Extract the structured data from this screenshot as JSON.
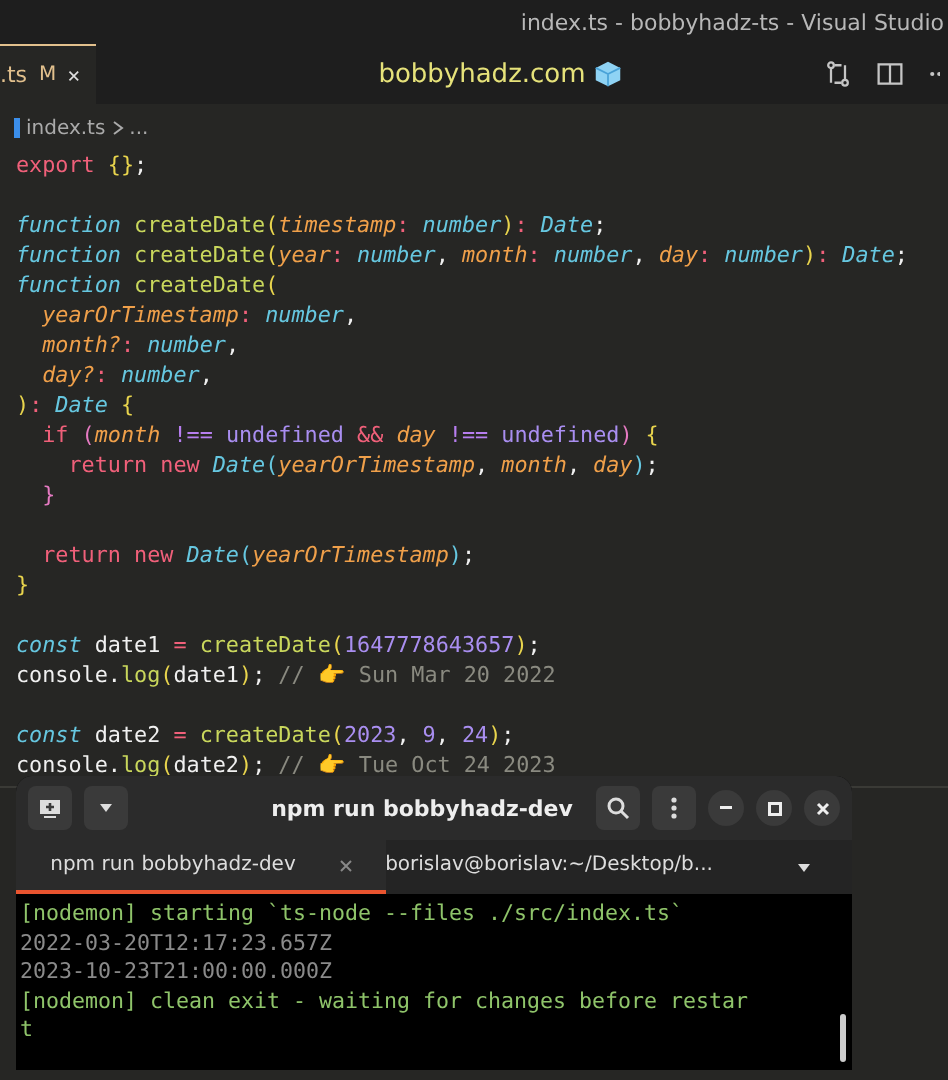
{
  "window": {
    "title": "index.ts - bobbyhadz-ts - Visual Studio"
  },
  "tabs": [
    {
      "label": ".ts",
      "status": "M",
      "selected": true
    }
  ],
  "banner": {
    "text": "bobbyhadz.com"
  },
  "breadcrumb": {
    "file": "index.ts",
    "rest": "..."
  },
  "code_blocks": [
    {
      "lines": [
        {
          "tokens": [
            {
              "kind": "kw",
              "text": "export"
            },
            {
              "kind": "brace",
              "text": " {}"
            },
            {
              "kind": "plain",
              "text": ";"
            }
          ]
        }
      ]
    },
    {
      "lines": [
        {
          "tokens": [
            {
              "kind": "storage",
              "text": "function"
            },
            {
              "kind": "fn",
              "text": " createDate"
            },
            {
              "kind": "brace",
              "text": "("
            },
            {
              "kind": "param",
              "text": "timestamp"
            },
            {
              "kind": "op",
              "text": ":"
            },
            {
              "kind": "type",
              "text": " number"
            },
            {
              "kind": "brace",
              "text": ")"
            },
            {
              "kind": "op",
              "text": ":"
            },
            {
              "kind": "type",
              "text": " Date"
            },
            {
              "kind": "plain",
              "text": ";"
            }
          ]
        },
        {
          "tokens": [
            {
              "kind": "storage",
              "text": "function"
            },
            {
              "kind": "fn",
              "text": " createDate"
            },
            {
              "kind": "brace",
              "text": "("
            },
            {
              "kind": "param",
              "text": "year"
            },
            {
              "kind": "op",
              "text": ":"
            },
            {
              "kind": "type",
              "text": " number"
            },
            {
              "kind": "plain",
              "text": ","
            },
            {
              "kind": "param",
              "text": " month"
            },
            {
              "kind": "op",
              "text": ":"
            },
            {
              "kind": "type",
              "text": " number"
            },
            {
              "kind": "plain",
              "text": ","
            },
            {
              "kind": "param",
              "text": " day"
            },
            {
              "kind": "op",
              "text": ":"
            },
            {
              "kind": "type",
              "text": " number"
            },
            {
              "kind": "brace",
              "text": ")"
            },
            {
              "kind": "op",
              "text": ":"
            },
            {
              "kind": "type",
              "text": " Date"
            },
            {
              "kind": "plain",
              "text": ";"
            }
          ]
        },
        {
          "tokens": [
            {
              "kind": "storage",
              "text": "function"
            },
            {
              "kind": "fn",
              "text": " createDate"
            },
            {
              "kind": "brace",
              "text": "("
            }
          ]
        },
        {
          "tokens": [
            {
              "kind": "param",
              "text": "  yearOrTimestamp"
            },
            {
              "kind": "op",
              "text": ":"
            },
            {
              "kind": "type",
              "text": " number"
            },
            {
              "kind": "plain",
              "text": ","
            }
          ]
        },
        {
          "tokens": [
            {
              "kind": "param",
              "text": "  month?"
            },
            {
              "kind": "op",
              "text": ":"
            },
            {
              "kind": "type",
              "text": " number"
            },
            {
              "kind": "plain",
              "text": ","
            }
          ]
        },
        {
          "tokens": [
            {
              "kind": "param",
              "text": "  day?"
            },
            {
              "kind": "op",
              "text": ":"
            },
            {
              "kind": "type",
              "text": " number"
            },
            {
              "kind": "plain",
              "text": ","
            }
          ]
        },
        {
          "tokens": [
            {
              "kind": "brace",
              "text": ")"
            },
            {
              "kind": "op",
              "text": ":"
            },
            {
              "kind": "type",
              "text": " Date"
            },
            {
              "kind": "brace",
              "text": " {"
            }
          ]
        },
        {
          "tokens": [
            {
              "kind": "kw",
              "text": "  if"
            },
            {
              "kind": "brace2",
              "text": " ("
            },
            {
              "kind": "param",
              "text": "month"
            },
            {
              "kind": "op2",
              "text": " !=="
            },
            {
              "kind": "ident",
              "text": " undefined"
            },
            {
              "kind": "op",
              "text": " &&"
            },
            {
              "kind": "param",
              "text": " day"
            },
            {
              "kind": "op2",
              "text": " !=="
            },
            {
              "kind": "ident",
              "text": " undefined"
            },
            {
              "kind": "brace2",
              "text": ")"
            },
            {
              "kind": "brace",
              "text": " {"
            }
          ]
        },
        {
          "tokens": [
            {
              "kind": "kw",
              "text": "    return"
            },
            {
              "kind": "kw",
              "text": " new"
            },
            {
              "kind": "type",
              "text": " Date"
            },
            {
              "kind": "brace3",
              "text": "("
            },
            {
              "kind": "param",
              "text": "yearOrTimestamp"
            },
            {
              "kind": "plain",
              "text": ","
            },
            {
              "kind": "param",
              "text": " month"
            },
            {
              "kind": "plain",
              "text": ","
            },
            {
              "kind": "param",
              "text": " day"
            },
            {
              "kind": "brace3",
              "text": ")"
            },
            {
              "kind": "plain",
              "text": ";"
            }
          ]
        },
        {
          "tokens": [
            {
              "kind": "brace2",
              "text": "  }"
            }
          ]
        }
      ]
    },
    {
      "lines": [
        {
          "tokens": [
            {
              "kind": "kw",
              "text": "  return"
            },
            {
              "kind": "kw",
              "text": " new"
            },
            {
              "kind": "type",
              "text": " Date"
            },
            {
              "kind": "brace3",
              "text": "("
            },
            {
              "kind": "param",
              "text": "yearOrTimestamp"
            },
            {
              "kind": "brace3",
              "text": ")"
            },
            {
              "kind": "plain",
              "text": ";"
            }
          ]
        },
        {
          "tokens": [
            {
              "kind": "brace",
              "text": "}"
            }
          ]
        }
      ]
    },
    {
      "lines": [
        {
          "tokens": [
            {
              "kind": "storage",
              "text": "const"
            },
            {
              "kind": "plain",
              "text": " date1"
            },
            {
              "kind": "op",
              "text": " ="
            },
            {
              "kind": "fn",
              "text": " createDate"
            },
            {
              "kind": "brace",
              "text": "("
            },
            {
              "kind": "num",
              "text": "1647778643657"
            },
            {
              "kind": "brace",
              "text": ")"
            },
            {
              "kind": "plain",
              "text": ";"
            }
          ]
        },
        {
          "tokens": [
            {
              "kind": "plain",
              "text": "console."
            },
            {
              "kind": "fn",
              "text": "log"
            },
            {
              "kind": "brace",
              "text": "("
            },
            {
              "kind": "plain",
              "text": "date1"
            },
            {
              "kind": "brace",
              "text": ")"
            },
            {
              "kind": "plain",
              "text": ";"
            },
            {
              "kind": "comment",
              "text": " // 👉 Sun Mar 20 2022"
            }
          ]
        }
      ]
    },
    {
      "lines": [
        {
          "tokens": [
            {
              "kind": "storage",
              "text": "const"
            },
            {
              "kind": "plain",
              "text": " date2"
            },
            {
              "kind": "op",
              "text": " ="
            },
            {
              "kind": "fn",
              "text": " createDate"
            },
            {
              "kind": "brace",
              "text": "("
            },
            {
              "kind": "num",
              "text": "2023"
            },
            {
              "kind": "plain",
              "text": ","
            },
            {
              "kind": "num",
              "text": " 9"
            },
            {
              "kind": "plain",
              "text": ","
            },
            {
              "kind": "num",
              "text": " 24"
            },
            {
              "kind": "brace",
              "text": ")"
            },
            {
              "kind": "plain",
              "text": ";"
            }
          ]
        },
        {
          "tokens": [
            {
              "kind": "plain",
              "text": "console."
            },
            {
              "kind": "fn",
              "text": "log"
            },
            {
              "kind": "brace",
              "text": "("
            },
            {
              "kind": "plain",
              "text": "date2"
            },
            {
              "kind": "brace",
              "text": ")"
            },
            {
              "kind": "plain",
              "text": ";"
            },
            {
              "kind": "comment",
              "text": " // 👉 Tue Oct 24 2023"
            }
          ]
        }
      ]
    }
  ],
  "terminal": {
    "title": "npm run bobbyhadz-dev",
    "tabs": [
      {
        "label": "npm run bobbyhadz-dev",
        "selected": true
      },
      {
        "label": "borislav@borislav:~/Desktop/b...",
        "selected": false
      }
    ],
    "lines": [
      {
        "kind": "info",
        "text": "[nodemon] starting `ts-node --files ./src/index.ts`"
      },
      {
        "kind": "output",
        "text": "2022-03-20T12:17:23.657Z"
      },
      {
        "kind": "output",
        "text": "2023-10-23T21:00:00.000Z"
      },
      {
        "kind": "info",
        "text": "[nodemon] clean exit - waiting for changes before restar"
      },
      {
        "kind": "info",
        "text": "t"
      }
    ]
  }
}
